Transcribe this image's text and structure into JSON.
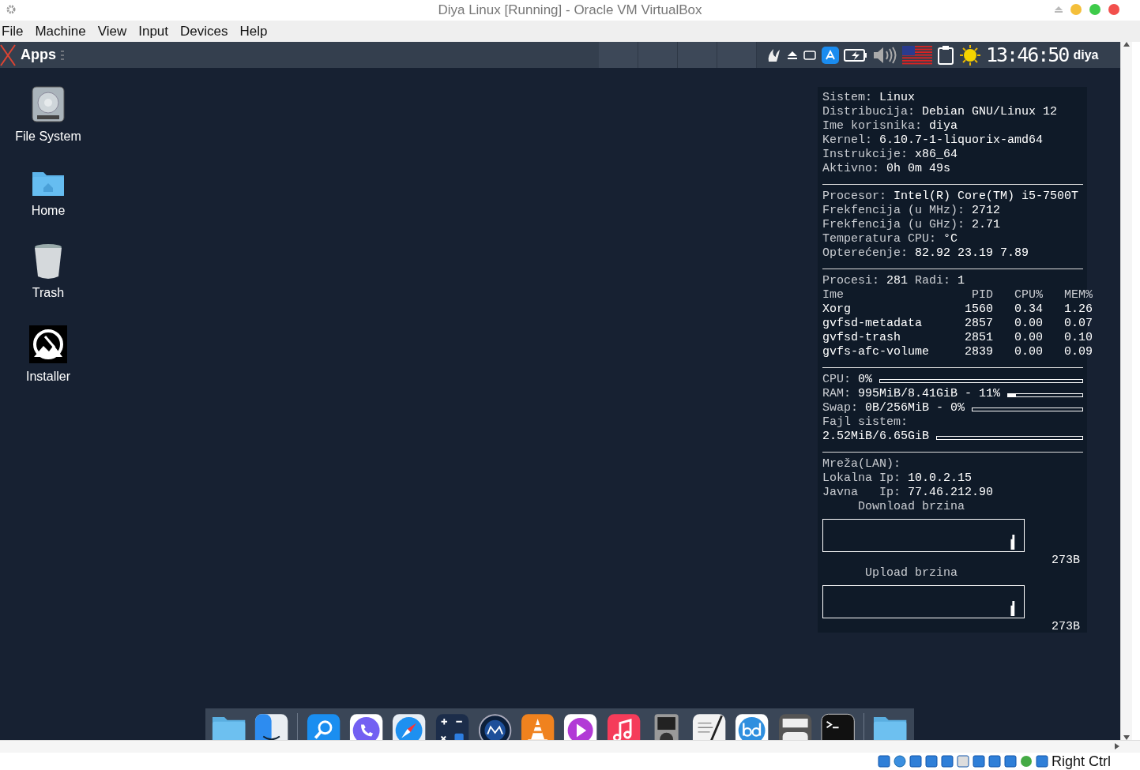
{
  "window": {
    "title": "Diya Linux [Running] - Oracle VM VirtualBox"
  },
  "menu": [
    "File",
    "Machine",
    "View",
    "Input",
    "Devices",
    "Help"
  ],
  "panel": {
    "apps_label": "Apps",
    "clock": "13:46:50",
    "user": "diya",
    "workspaces": [
      {
        "selected": false
      },
      {
        "selected": false
      },
      {
        "selected": false
      },
      {
        "selected": false
      }
    ]
  },
  "desktop_icons": [
    {
      "kind": "drive",
      "label": "File System"
    },
    {
      "kind": "folder",
      "label": "Home"
    },
    {
      "kind": "trash",
      "label": "Trash"
    },
    {
      "kind": "installer",
      "label": "Installer"
    }
  ],
  "conky": {
    "system": [
      {
        "label": "Sistem:",
        "value": "Linux"
      },
      {
        "label": "Distribucija:",
        "value": "Debian GNU/Linux 12"
      },
      {
        "label": "Ime korisnika:",
        "value": "diya"
      },
      {
        "label": "Kernel:",
        "value": "6.10.7-1-liquorix-amd64"
      },
      {
        "label": "Instrukcije:",
        "value": "x86_64"
      },
      {
        "label": "Aktivno:",
        "value": "0h 0m 49s"
      }
    ],
    "cpu": [
      {
        "label": "Procesor:",
        "value": "Intel(R) Core(TM) i5-7500T"
      },
      {
        "label": "Frekfencija (u MHz):",
        "value": "2712"
      },
      {
        "label": "Frekfencija (u GHz):",
        "value": "2.71"
      },
      {
        "label": "Temperatura CPU:",
        "value": "°C"
      },
      {
        "label": "Opterećenje:",
        "value": "82.92 23.19 7.89"
      }
    ],
    "processes": {
      "summary": [
        {
          "label": "Procesi:",
          "value": "281"
        },
        {
          "label": "Radi:",
          "value": "1"
        }
      ],
      "columns": [
        "Ime",
        "PID",
        "CPU%",
        "MEM%"
      ],
      "rows": [
        [
          "Xorg",
          "1560",
          "0.34",
          "1.26"
        ],
        [
          "gvfsd-metadata",
          "2857",
          "0.00",
          "0.07"
        ],
        [
          "gvfsd-trash",
          "2851",
          "0.00",
          "0.10"
        ],
        [
          "gvfs-afc-volume",
          "2839",
          "0.00",
          "0.09"
        ]
      ]
    },
    "usage": [
      {
        "kind": "inline",
        "label": "CPU:",
        "value": "0%",
        "level": 0
      },
      {
        "kind": "inline",
        "label": "RAM:",
        "value": "995MiB/8.41GiB - 11%",
        "level": 0.11
      },
      {
        "kind": "inline",
        "label": "Swap:",
        "value": "0B/256MiB - 0%",
        "level": 0
      },
      {
        "kind": "wrapped",
        "label": "Fajl sistem:",
        "value": "2.52MiB/6.65GiB",
        "level": 0
      }
    ],
    "network": {
      "title": "Mreža(LAN):",
      "lines": [
        {
          "label": "Lokalna Ip:",
          "value": "10.0.2.15"
        },
        {
          "label": "Javna   Ip:",
          "value": "77.46.212.90"
        }
      ],
      "graphs": [
        {
          "title": "Download brzina",
          "reading": "273B"
        },
        {
          "title": "Upload brzina",
          "reading": "273B"
        }
      ]
    }
  },
  "dock": [
    {
      "kind": "folder"
    },
    {
      "kind": "finder"
    },
    {
      "kind": "search"
    },
    {
      "kind": "viber"
    },
    {
      "kind": "safari"
    },
    {
      "kind": "calculator"
    },
    {
      "kind": "mc"
    },
    {
      "kind": "vlc"
    },
    {
      "kind": "player"
    },
    {
      "kind": "music"
    },
    {
      "kind": "ipod"
    },
    {
      "kind": "notes"
    },
    {
      "kind": "torrent"
    },
    {
      "kind": "rtc"
    },
    {
      "kind": "terminal"
    },
    {
      "kind": "folder"
    }
  ],
  "status_bar": {
    "host_key": "Right Ctrl"
  }
}
